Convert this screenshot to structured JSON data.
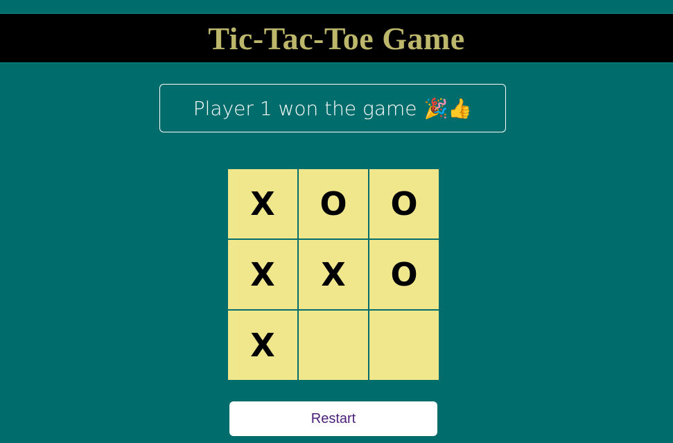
{
  "header": {
    "title": "Tic-Tac-Toe Game"
  },
  "status": {
    "message": "Player 1 won the game",
    "emoji": "🎉👍"
  },
  "board": {
    "cells": [
      "X",
      "O",
      "O",
      "X",
      "X",
      "O",
      "X",
      "",
      ""
    ]
  },
  "controls": {
    "restart_label": "Restart"
  },
  "colors": {
    "background": "#006c6c",
    "header_bg": "#000000",
    "title": "#bdb76b",
    "cell": "#f0e68c",
    "restart_text": "#4b1d7a"
  }
}
